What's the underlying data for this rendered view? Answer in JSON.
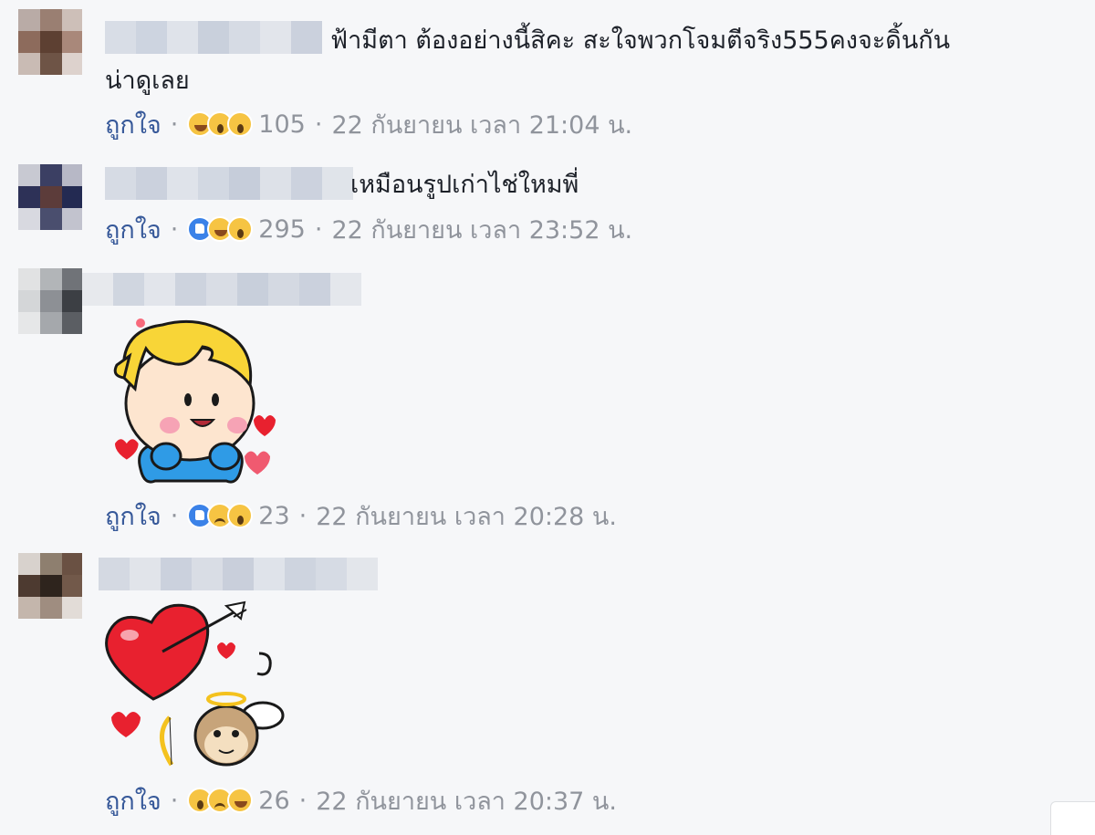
{
  "comments": [
    {
      "text_line1": "ฟ้ามีตา ต้องอย่างนี้สิคะ สะใจพวกโจมตีจริง555คงจะดิ้นกัน",
      "text_line2": "น่าดูเลย",
      "like_label": "ถูกใจ",
      "reactions": [
        "haha",
        "wow",
        "wow"
      ],
      "reaction_count": "105",
      "timestamp": "22 กันยายน เวลา 21:04 น."
    },
    {
      "text_line1": "เหมือนรูปเก่าไช่ใหมพี่",
      "like_label": "ถูกใจ",
      "reactions": [
        "like",
        "haha",
        "wow"
      ],
      "reaction_count": "295",
      "timestamp": "22 กันยายน เวลา 23:52 น."
    },
    {
      "sticker": "boy-hearts-sticker",
      "like_label": "ถูกใจ",
      "reactions": [
        "like",
        "sad",
        "wow"
      ],
      "reaction_count": "23",
      "timestamp": "22 กันยายน เวลา 20:28 น."
    },
    {
      "sticker": "heart-arrow-monkey-sticker",
      "like_label": "ถูกใจ",
      "reactions": [
        "wow",
        "sad",
        "haha"
      ],
      "reaction_count": "26",
      "timestamp": "22 กันยายน เวลา 20:37 น."
    }
  ],
  "separator": "·",
  "colors": {
    "background": "#f6f7f9",
    "link": "#365899",
    "meta": "#90949c",
    "text": "#1d2129"
  }
}
